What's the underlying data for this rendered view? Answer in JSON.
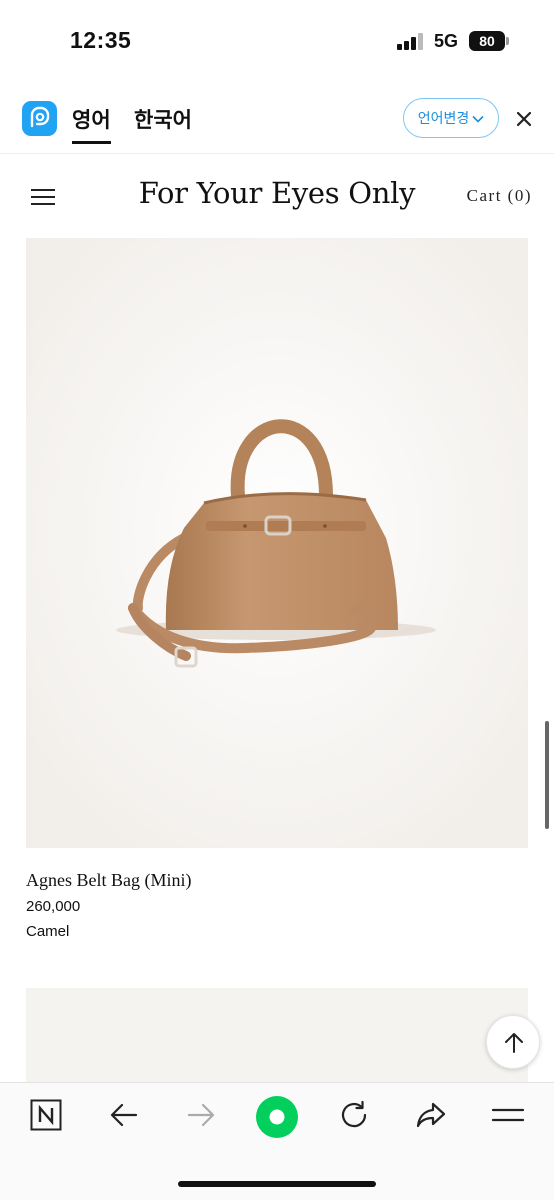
{
  "status_bar": {
    "time": "12:35",
    "network": "5G",
    "battery": "80"
  },
  "translate_bar": {
    "tabs": [
      {
        "label": "영어",
        "active": true
      },
      {
        "label": "한국어",
        "active": false
      }
    ],
    "change_language_label": "언어변경",
    "accent_color": "#1fa3f2"
  },
  "site_header": {
    "title": "For Your Eyes Only",
    "cart_label": "Cart (0)"
  },
  "product": {
    "name": "Agnes Belt Bag (Mini)",
    "price": "260,000",
    "color": "Camel",
    "image_icon": "tan-leather-handbag"
  },
  "toolbar": {
    "items": [
      "naver-home-icon",
      "back-arrow-icon",
      "forward-arrow-icon",
      "green-circle-icon",
      "refresh-icon",
      "share-icon",
      "menu-icon"
    ],
    "accent_color": "#03cf5d"
  }
}
